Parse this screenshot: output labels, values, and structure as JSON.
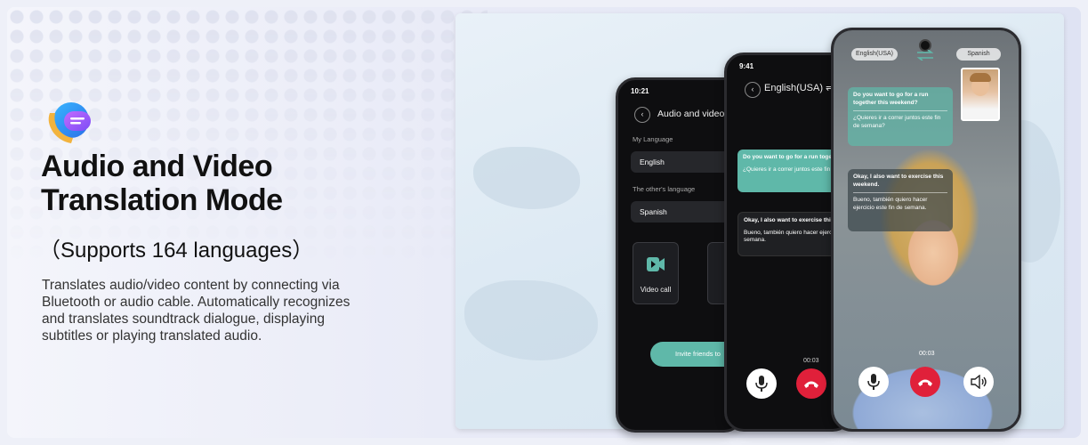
{
  "hero": {
    "title_line1": "Audio and Video",
    "title_line2": "Translation Mode",
    "subtitle": "（Supports 164 languages）",
    "description": "Translates audio/video content by connecting via Bluetooth or audio cable. Automatically recognizes and translates soundtrack dialogue, displaying subtitles or playing translated audio."
  },
  "phone1": {
    "time": "10:21",
    "title": "Audio and video tra",
    "my_language_label": "My Language",
    "my_language_value": "English",
    "other_language_label": "The other's language",
    "other_language_value": "Spanish",
    "mode_video": "Video call",
    "invite_label": "Invite friends to"
  },
  "phone2": {
    "time": "9:41",
    "header": "English(USA) ⇌ Sp",
    "msg1_en": "Do you want to go for a run togethe",
    "msg1_es": "¿Quieres ir a correr juntos este fin",
    "msg2_en": "Okay, I also want to exercise this w",
    "msg2_es": "Bueno, también quiero hacer ejercic semana.",
    "timer": "00:03"
  },
  "phone3": {
    "lang_left": "English(USA)",
    "lang_right": "Spanish",
    "msg1_en": "Do you want to go for a run together this weekend?",
    "msg1_es": "¿Quieres ir a correr juntos este fin de semana?",
    "msg2_en": "Okay, I also want to exercise this weekend.",
    "msg2_es": "Bueno, también quiero hacer ejercicio este fin de semana.",
    "timer": "00:03"
  },
  "colors": {
    "accent_teal": "#5fb8a9",
    "end_call_red": "#e0203a"
  }
}
